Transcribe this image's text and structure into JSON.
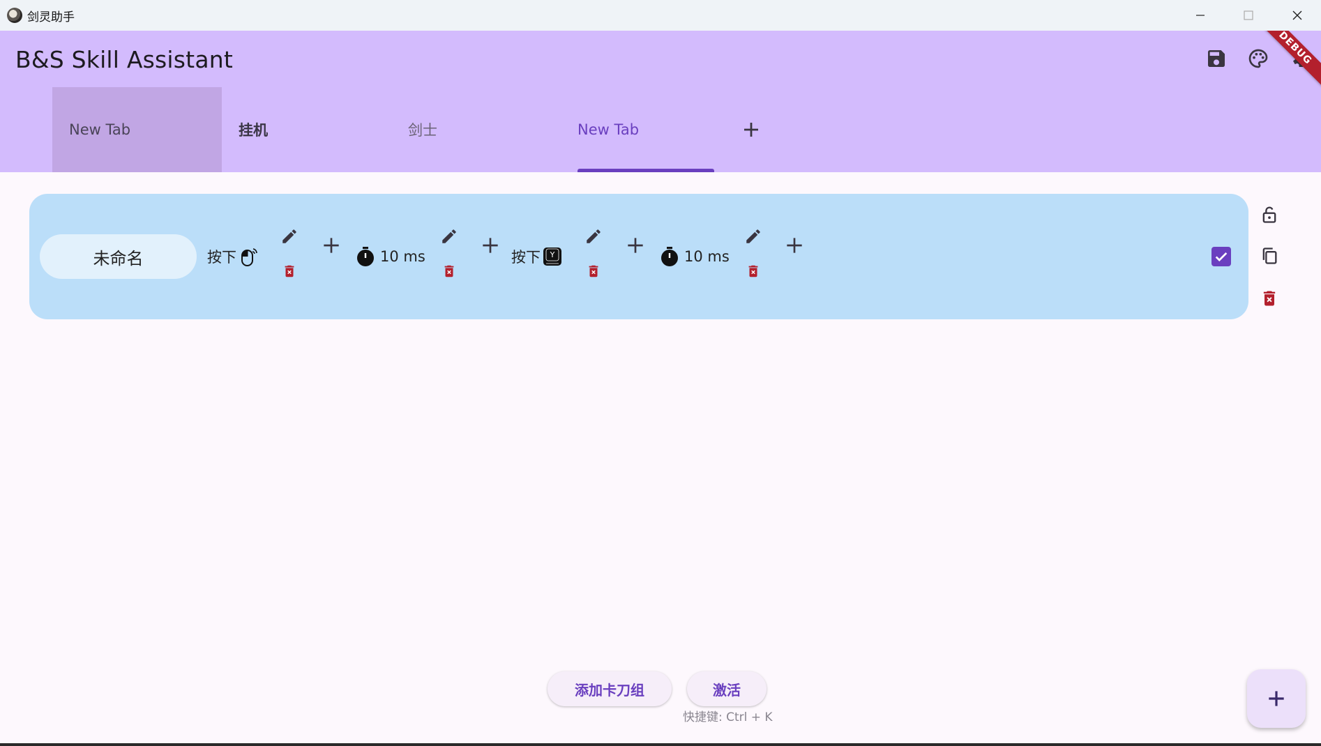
{
  "window": {
    "title": "剑灵助手"
  },
  "appbar": {
    "title": "B&S Skill Assistant",
    "debug_banner": "DEBUG"
  },
  "tabs": [
    {
      "label": "New Tab"
    },
    {
      "label": "挂机"
    },
    {
      "label": "剑士"
    },
    {
      "label": "New Tab"
    }
  ],
  "card": {
    "name": "未命名",
    "steps": [
      {
        "label": "按下",
        "icon": "mouse-icon"
      },
      {
        "label": "10 ms",
        "icon": "timer-icon"
      },
      {
        "label": "按下",
        "icon": "keycap-y-icon",
        "key": "Y"
      },
      {
        "label": "10 ms",
        "icon": "timer-icon"
      }
    ],
    "enabled": true
  },
  "bottom": {
    "add_group_label": "添加卡刀组",
    "activate_label": "激活",
    "shortcut_hint": "快捷键: Ctrl + K"
  },
  "colors": {
    "appbar": "#d3bbfd",
    "accent": "#6a3fbf",
    "card": "#bbdef9",
    "danger": "#b3202d"
  }
}
